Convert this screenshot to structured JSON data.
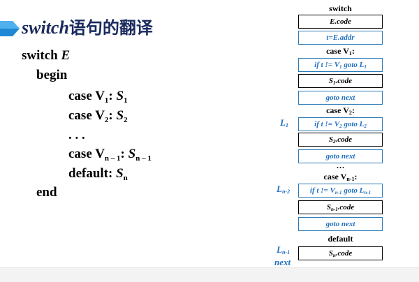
{
  "title": {
    "keyword": "switch",
    "text": "语句的翻译"
  },
  "code": {
    "line1_kw": "switch",
    "line1_var": "E",
    "line2": "begin",
    "case1_kw": "case",
    "case1_v": "V",
    "case1_v_sub": "1",
    "case1_s": "S",
    "case1_s_sub": "1",
    "case2_kw": "case",
    "case2_v": "V",
    "case2_v_sub": "2",
    "case2_s": "S",
    "case2_s_sub": "2",
    "dots": ". . .",
    "casen_kw": "case",
    "casen_v": "V",
    "casen_v_sub": "n – 1",
    "casen_s": "S",
    "casen_s_sub": "n – 1",
    "default_kw": "default:",
    "default_s": "S",
    "default_s_sub": "n",
    "end": "end"
  },
  "diagram": {
    "header": "switch",
    "e_code": "E.code",
    "t_assign": "t=E.addr",
    "case1_label": "case V",
    "case1_sub": "1",
    "if1_pre": "if t != V",
    "if1_vsub": "1",
    "if1_mid": " goto L",
    "if1_lsub": "1",
    "s1_pre": "S",
    "s1_sub": "1",
    "s1_post": ".code",
    "goto_next_1": "goto next",
    "case2_label": "case V",
    "case2_sub": "2",
    "if2_pre": "if t != V",
    "if2_vsub": "2",
    "if2_mid": " goto L",
    "if2_lsub": "2",
    "s2_pre": "S",
    "s2_sub": "2",
    "s2_post": ".code",
    "goto_next_2": "goto next",
    "ellipsis": "…",
    "casen_label": "case V",
    "casen_sub": "n-1",
    "ifn_pre": "if t != V",
    "ifn_vsub": "n-1",
    "ifn_mid": " goto L",
    "ifn_lsub": "n-1",
    "sn1_pre": "S",
    "sn1_sub": "n-1",
    "sn1_post": ".code",
    "goto_next_3": "goto next",
    "default_label": "default",
    "sn_pre": "S",
    "sn_sub": "n",
    "sn_post": ".code",
    "side_l1": "L",
    "side_l1_sub": "1",
    "side_ln2": "L",
    "side_ln2_sub": "n-2",
    "side_ln1": "L",
    "side_ln1_sub": "n-1",
    "side_next": "next"
  },
  "colors": {
    "title": "#1a2b5e",
    "accent_blue": "#1f6fc0",
    "marker": "#1e88d6"
  }
}
